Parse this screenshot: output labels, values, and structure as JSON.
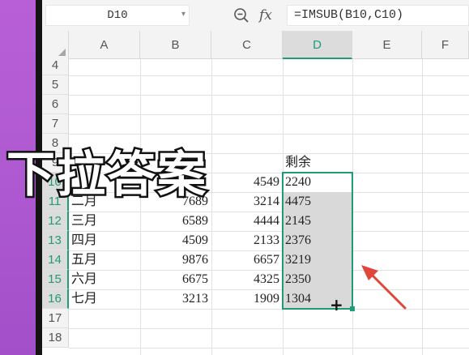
{
  "formula_bar": {
    "name_box": "D10",
    "fx_label": "fx",
    "formula": "=IMSUB(B10,C10)"
  },
  "columns": [
    "A",
    "B",
    "C",
    "D",
    "E",
    "F"
  ],
  "rows": [
    "4",
    "5",
    "6",
    "7",
    "8",
    "9",
    "10",
    "11",
    "12",
    "13",
    "14",
    "15",
    "16",
    "17",
    "18"
  ],
  "header_cell": "剩余",
  "data_rows": [
    {
      "row": "10",
      "a": "",
      "b": "",
      "c": "4549",
      "d": "2240"
    },
    {
      "row": "11",
      "a": "二月",
      "b": "7689",
      "c": "3214",
      "d": "4475"
    },
    {
      "row": "12",
      "a": "三月",
      "b": "6589",
      "c": "4444",
      "d": "2145"
    },
    {
      "row": "13",
      "a": "四月",
      "b": "4509",
      "c": "2133",
      "d": "2376"
    },
    {
      "row": "14",
      "a": "五月",
      "b": "9876",
      "c": "6657",
      "d": "3219"
    },
    {
      "row": "15",
      "a": "六月",
      "b": "6675",
      "c": "4325",
      "d": "2350"
    },
    {
      "row": "16",
      "a": "七月",
      "b": "3213",
      "c": "1909",
      "d": "1304"
    }
  ],
  "overlay_caption": "下拉答案",
  "colors": {
    "accent": "#1f9b77",
    "selection_fill": "#d9d9d9",
    "arrow": "#e0463a"
  }
}
